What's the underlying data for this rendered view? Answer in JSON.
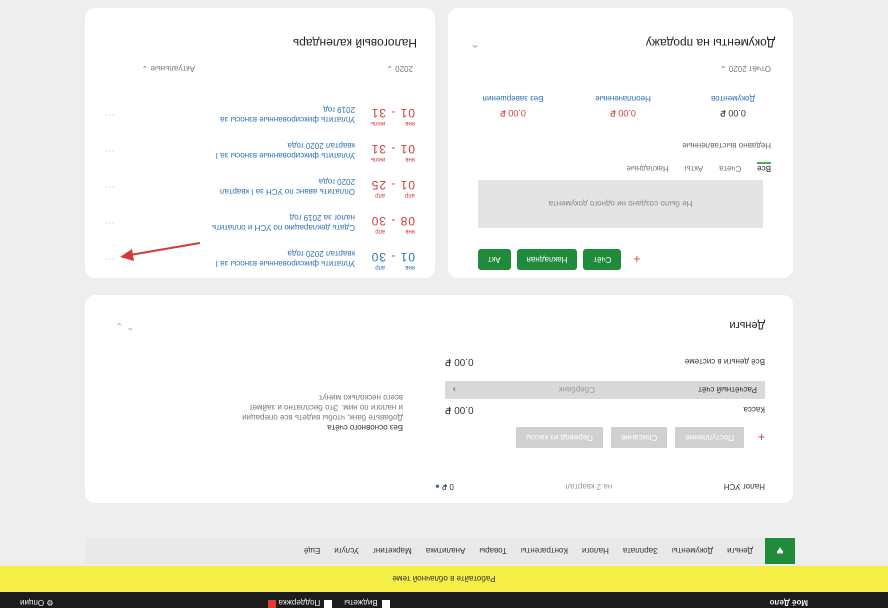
{
  "calendar": {
    "title": "Налоговый календарь",
    "year": "2020 ⌄",
    "all_link": "Актуальные ⌄",
    "items": [
      {
        "days": "01 - 30",
        "months": [
          "янв",
          "апр"
        ],
        "line1": "Уплатить фиксированные взносы за I",
        "line2": "квартал 2020 года",
        "color": "blue"
      },
      {
        "days": "08 - 30",
        "months": [
          "янв",
          "апр"
        ],
        "line1": "Сдать декларацию по УСН и оплатить",
        "line2": "налог за 2019 год",
        "color": "red"
      },
      {
        "days": "01 - 25",
        "months": [
          "апр",
          "апр"
        ],
        "line1": "Оплатить аванс по УСН за I квартал",
        "line2": "2020 года",
        "color": "red"
      },
      {
        "days": "01 - 31",
        "months": [
          "янв",
          "июль"
        ],
        "line1": "Уплатить фиксированные взносы за I",
        "line2": "квартал 2020 года",
        "color": "red"
      },
      {
        "days": "01 - 31",
        "months": [
          "янв",
          "июль"
        ],
        "line1": "Уплатить фиксированные взносы за",
        "line2": "2019 год",
        "color": "red"
      }
    ]
  },
  "docs": {
    "title": "Документы на продажу",
    "year": "Отчёт  2020 ⌄",
    "stats": [
      {
        "value": "0.00 ₽",
        "label": "Документов"
      },
      {
        "value": "0.00 ₽",
        "label": "Неоплаченные"
      },
      {
        "value": "0.00 ₽",
        "label": "Без завершения"
      }
    ],
    "recent_label": "Недавно выставленные",
    "tabs": [
      "Все",
      "Счета",
      "Акты",
      "Накладные"
    ],
    "empty": "Не было создано ни одного документа",
    "buttons": [
      "Счёт",
      "Накладная",
      "Акт"
    ],
    "plus": "+"
  },
  "money": {
    "title": "Деньги",
    "total_label": "Всё деньги в системе",
    "total_value": "0.00 ₽",
    "account_label": "Расчётный счёт",
    "account_sub": "Сбербанк",
    "cash_label": "Касса",
    "cash_value": "0.00 ₽",
    "ops": [
      "Поступление",
      "Списание",
      "Перевод из кассы"
    ],
    "plus": "+",
    "tax_label": "Налог УСН",
    "tax_mid": "на 2 квартал",
    "tax_value": "0 ₽",
    "info_head": "Без основного счёта",
    "info_lines": [
      "Добавьте банк, чтобы видеть все операции",
      "и налоги по ним. Это бесплатно и займет",
      "всего несколько минут."
    ]
  },
  "nav": {
    "items": [
      "Деньги",
      "Документы",
      "Зарплата",
      "Налоги",
      "Контрагенты",
      "Товары",
      "Аналитика",
      "Маркетинг",
      "Услуги",
      "Ещё"
    ]
  },
  "banner": "Работайте в облачной теме",
  "footer": {
    "brand": "Моё Дело",
    "middle1": "Виджеты",
    "middle2": "Поддержка",
    "right": "Опции"
  }
}
